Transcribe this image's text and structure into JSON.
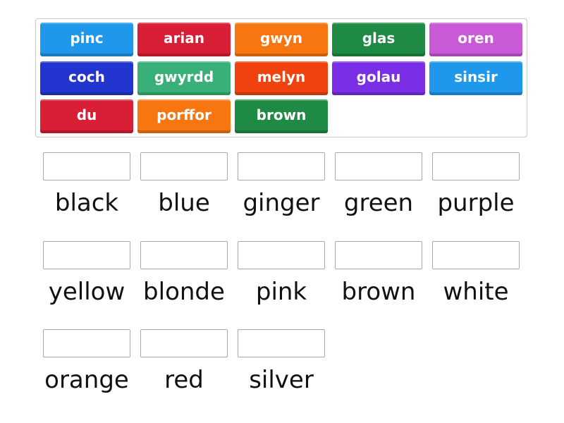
{
  "tiles": [
    {
      "text": "pinc",
      "color": "#1f97ea"
    },
    {
      "text": "arian",
      "color": "#d81f35"
    },
    {
      "text": "gwyn",
      "color": "#f8760f"
    },
    {
      "text": "glas",
      "color": "#1f8a43"
    },
    {
      "text": "oren",
      "color": "#c95ad6"
    },
    {
      "text": "coch",
      "color": "#2236cf"
    },
    {
      "text": "gwyrdd",
      "color": "#38b078"
    },
    {
      "text": "melyn",
      "color": "#f0420e"
    },
    {
      "text": "golau",
      "color": "#7a2ee6"
    },
    {
      "text": "sinsir",
      "color": "#1f97ea"
    },
    {
      "text": "du",
      "color": "#d81f35"
    },
    {
      "text": "porffor",
      "color": "#f8760f"
    },
    {
      "text": "brown",
      "color": "#1f8a43"
    }
  ],
  "targets": [
    {
      "label": "black"
    },
    {
      "label": "blue"
    },
    {
      "label": "ginger"
    },
    {
      "label": "green"
    },
    {
      "label": "purple"
    },
    {
      "label": "yellow"
    },
    {
      "label": "blonde"
    },
    {
      "label": "pink"
    },
    {
      "label": "brown"
    },
    {
      "label": "white"
    },
    {
      "label": "orange"
    },
    {
      "label": "red"
    },
    {
      "label": "silver"
    }
  ]
}
